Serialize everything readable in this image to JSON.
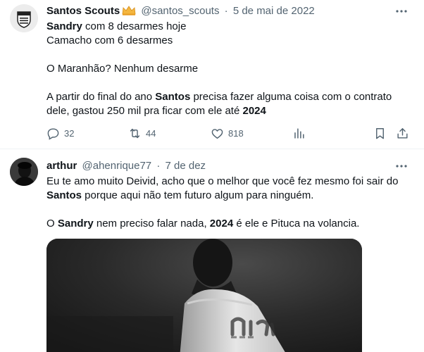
{
  "tweet1": {
    "display_name": "Santos Scouts",
    "handle": "@santos_scouts",
    "separator": "·",
    "date": "5 de mai de 2022",
    "lines": {
      "l1_bold": "Sandry",
      "l1_rest": " com 8 desarmes hoje",
      "l2": "Camacho com 6 desarmes",
      "l3": "O Maranhão? Nenhum desarme",
      "l4_a": "A partir do final do ano ",
      "l4_bold": "Santos",
      "l4_b": " precisa fazer alguma coisa com o contrato",
      "l5_a": "dele, gastou 250 mil pra ficar com ele até ",
      "l5_bold": "2024"
    },
    "actions": {
      "replies": "32",
      "retweets": "44",
      "likes": "818"
    }
  },
  "tweet2": {
    "display_name": "arthur",
    "handle": "@ahenrique77",
    "separator": "·",
    "date": "7 de dez",
    "lines": {
      "l1": "Eu te amo muito Deivid, acho que o melhor que você fez mesmo foi sair do",
      "l2_bold": "Santos",
      "l2_rest": " porque aqui não tem futuro algum para ninguém.",
      "l3_a": "O ",
      "l3_bold1": "Sandry",
      "l3_b": " nem preciso falar nada, ",
      "l3_bold2": "2024",
      "l3_c": " é ele e Pituca na volancia."
    }
  },
  "colors": {
    "text": "#0f1419",
    "secondary": "#536471",
    "divider": "#eff3f4",
    "crown": "#f4b63f"
  },
  "icons": [
    "more-icon",
    "crown-icon",
    "reply-icon",
    "retweet-icon",
    "like-icon",
    "views-icon",
    "bookmark-icon",
    "share-icon"
  ]
}
